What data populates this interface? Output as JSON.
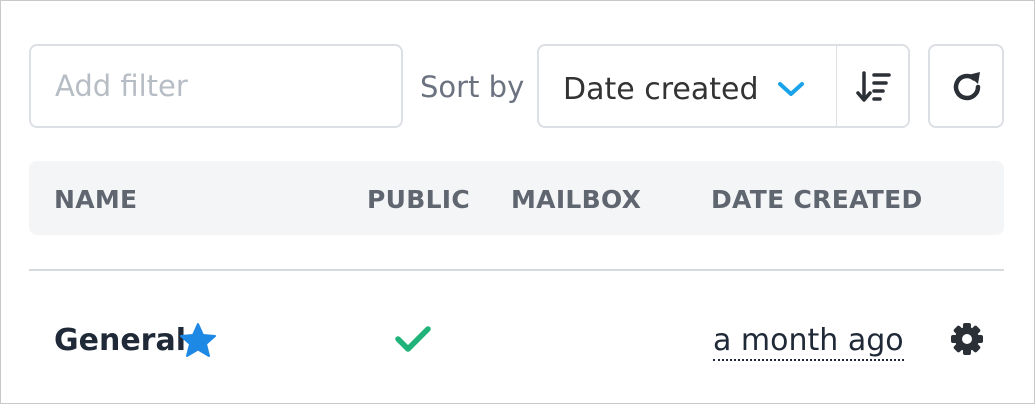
{
  "filter": {
    "placeholder": "Add filter",
    "value": ""
  },
  "sort": {
    "label": "Sort by",
    "selected": "Date created",
    "direction_icon": "sort-descending-icon",
    "chevron_icon": "chevron-down-icon"
  },
  "refresh_icon": "refresh-icon",
  "table": {
    "columns": [
      "NAME",
      "PUBLIC",
      "MAILBOX",
      "DATE CREATED"
    ],
    "rows": [
      {
        "name": "General",
        "starred": true,
        "public": true,
        "mailbox": "",
        "date_created": "a month ago"
      }
    ]
  },
  "colors": {
    "accent_blue": "#1e88e5",
    "chevron_blue": "#1aa3e8",
    "check_green": "#1fb37a",
    "header_bg": "#f4f5f7",
    "header_text": "#5f6670"
  }
}
